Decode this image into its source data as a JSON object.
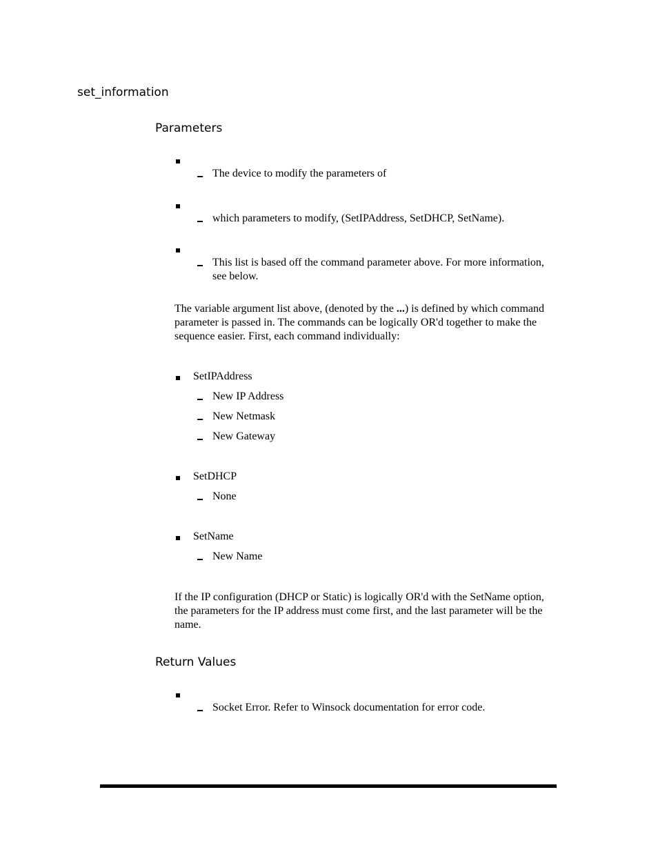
{
  "title": "set_information",
  "parameters": {
    "heading": "Parameters",
    "items": [
      {
        "name": "",
        "description": "The device to modify the parameters of"
      },
      {
        "name": "",
        "description": "which parameters to modify, (SetIPAddress, SetDHCP, SetName)."
      },
      {
        "name": "",
        "description_line1": "This list is based off the command parameter above. For more information,",
        "description_line2": "see below."
      }
    ],
    "intro_lines": [
      "The variable argument list above, (denoted by the ",
      "...",
      ") is defined by which command",
      "parameter is passed in. The commands can be logically OR'd together to make the",
      "sequence easier. First, each command individually:"
    ],
    "commands": [
      {
        "name": "SetIPAddress",
        "args": [
          "New IP Address",
          "New Netmask",
          "New Gateway"
        ]
      },
      {
        "name": "SetDHCP",
        "args": [
          "None"
        ]
      },
      {
        "name": "SetName",
        "args": [
          "New Name"
        ]
      }
    ],
    "note_lines": [
      "If the IP configuration (DHCP or Static) is logically OR'd with the SetName option,",
      "the parameters for the IP address must come first, and the last parameter will be the",
      "name."
    ]
  },
  "return_values": {
    "heading": "Return Values",
    "items": [
      {
        "name": "",
        "description": "Socket Error. Refer to Winsock documentation for error code."
      }
    ]
  }
}
